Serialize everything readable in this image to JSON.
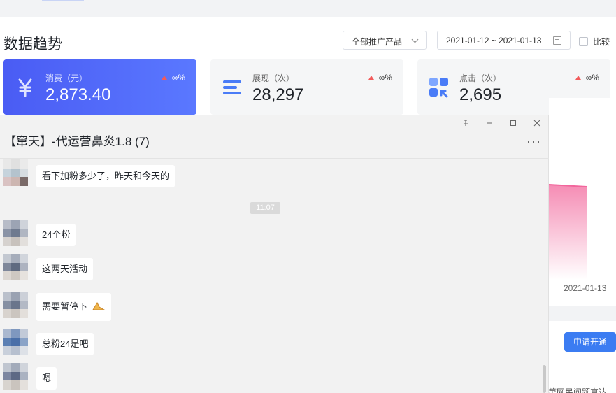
{
  "dashboard": {
    "section_title": "数据趋势",
    "product_dropdown": "全部推广产品",
    "date_range": "2021-01-12 ~ 2021-01-13",
    "compare_label": "比较",
    "cards": [
      {
        "label": "消费（元）",
        "value": "2,873.40",
        "trend": "∞%",
        "icon": "yuan-icon",
        "active": true
      },
      {
        "label": "展现（次）",
        "value": "28,297",
        "trend": "∞%",
        "icon": "list-icon",
        "active": false
      },
      {
        "label": "点击（次）",
        "value": "2,695",
        "trend": "∞%",
        "icon": "click-icon",
        "active": false
      }
    ],
    "chart_xlabel": "2021-01-13",
    "apply_button": "申请开通",
    "cut_text": "第网民问题直达",
    "colors": {
      "accent": "#4a5cf4",
      "chart_pink": "#f58cb4",
      "trend_up": "#f25b5b"
    }
  },
  "chat": {
    "title": "【窜天】-代运营鼻炎1.8 (7)",
    "time_divider": "11:07",
    "messages": [
      {
        "text": "看下加粉多少了，昨天和今天的"
      },
      {
        "text": "24个粉"
      },
      {
        "text": "这两天活动"
      },
      {
        "text": "需要暂停下"
      },
      {
        "text": "总粉24是吧"
      },
      {
        "text": "嗯"
      }
    ]
  }
}
